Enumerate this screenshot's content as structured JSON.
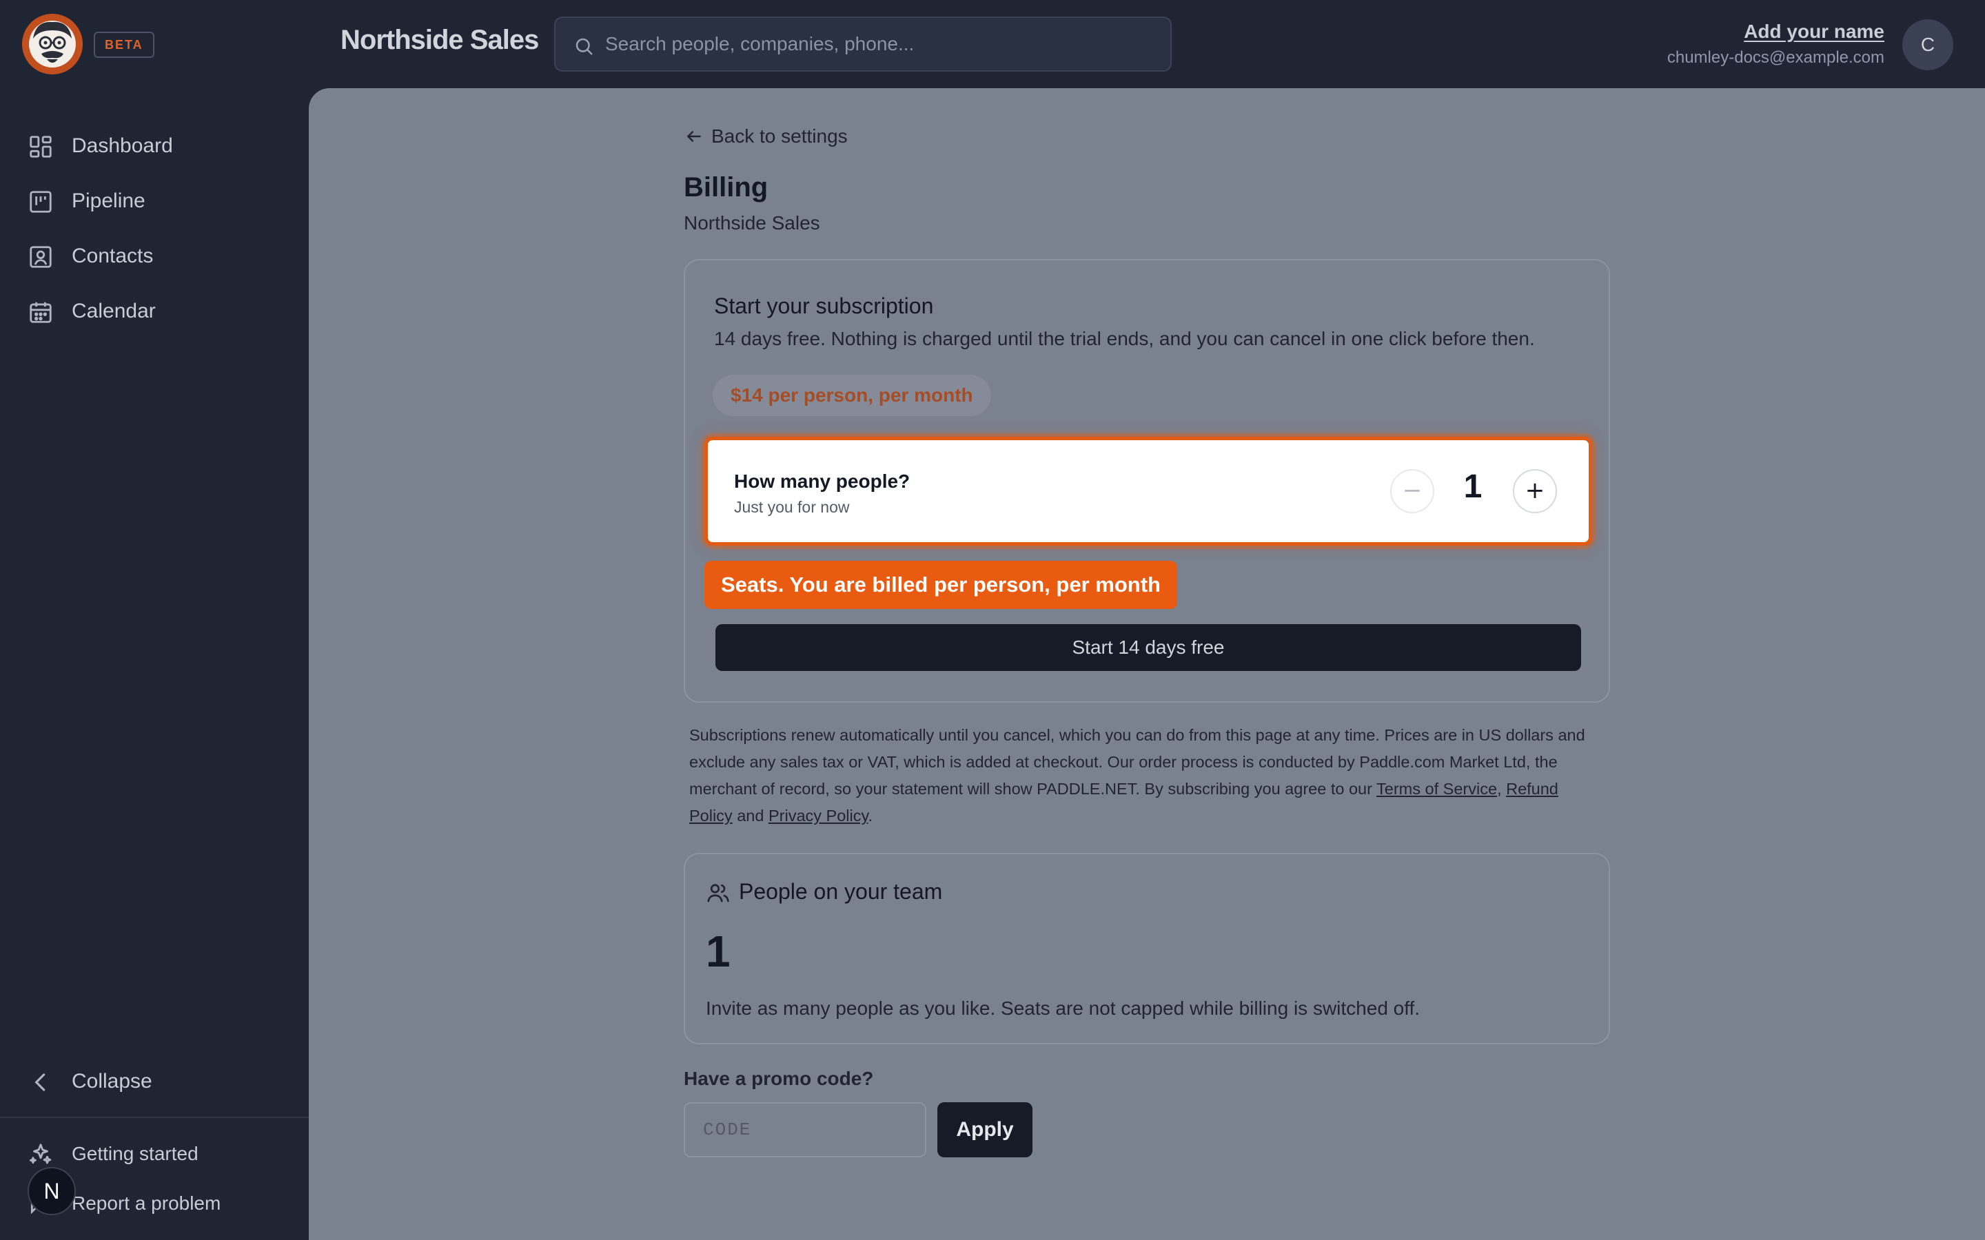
{
  "app": {
    "brand": "Northside Sales",
    "badge": "BETA",
    "logo_icon": "mascot-logo-icon",
    "accent": "#ea5b12"
  },
  "search": {
    "placeholder": "Search people, companies, phone...",
    "icon": "search-icon"
  },
  "user": {
    "name": "Add your name",
    "email": "chumley-docs@example.com",
    "avatar_initial": "C"
  },
  "sidebar": {
    "items": [
      {
        "label": "Dashboard",
        "icon": "dashboard-icon"
      },
      {
        "label": "Pipeline",
        "icon": "pipeline-icon"
      },
      {
        "label": "Contacts",
        "icon": "contacts-icon"
      },
      {
        "label": "Calendar",
        "icon": "calendar-icon"
      }
    ],
    "collapse_label": "Collapse",
    "getting_started_label": "Getting started",
    "report_label": "Report a problem",
    "help_badge": "N"
  },
  "billing": {
    "back_label": "Back to settings",
    "title": "Billing",
    "subtitle": "Northside Sales",
    "subscription": {
      "title": "Start your subscription",
      "description": "14 days free. Nothing is charged until the trial ends, and you can cancel in one click before then.",
      "price": "$14 per person, per month",
      "seats_question": "How many people?",
      "seats_hint": "Just you for now",
      "seat_count": "1",
      "minus_symbol": "−",
      "plus_symbol": "+",
      "tooltip": "Seats. You are billed per person, per month",
      "start_button": "Start 14 days free"
    },
    "legal": {
      "text": "Subscriptions renew automatically until you cancel, which you can do from this page at any time. Prices are in US dollars and exclude any sales tax or VAT, which is added at checkout. Our order process is conducted by Paddle.com Market Ltd, the merchant of record, so your statement will show PADDLE.NET. By subscribing you agree to our ",
      "terms_link": "Terms of Service",
      "sep": ", ",
      "refund_link": "Refund Policy",
      "and_text": " and ",
      "privacy_link": "Privacy Policy",
      "end": "."
    },
    "team": {
      "title": "People on your team",
      "count": "1",
      "note": "Invite as many people as you like. Seats are not capped while billing is switched off."
    },
    "promo": {
      "label": "Have a promo code?",
      "placeholder": "CODE",
      "value": "",
      "apply_label": "Apply"
    }
  }
}
